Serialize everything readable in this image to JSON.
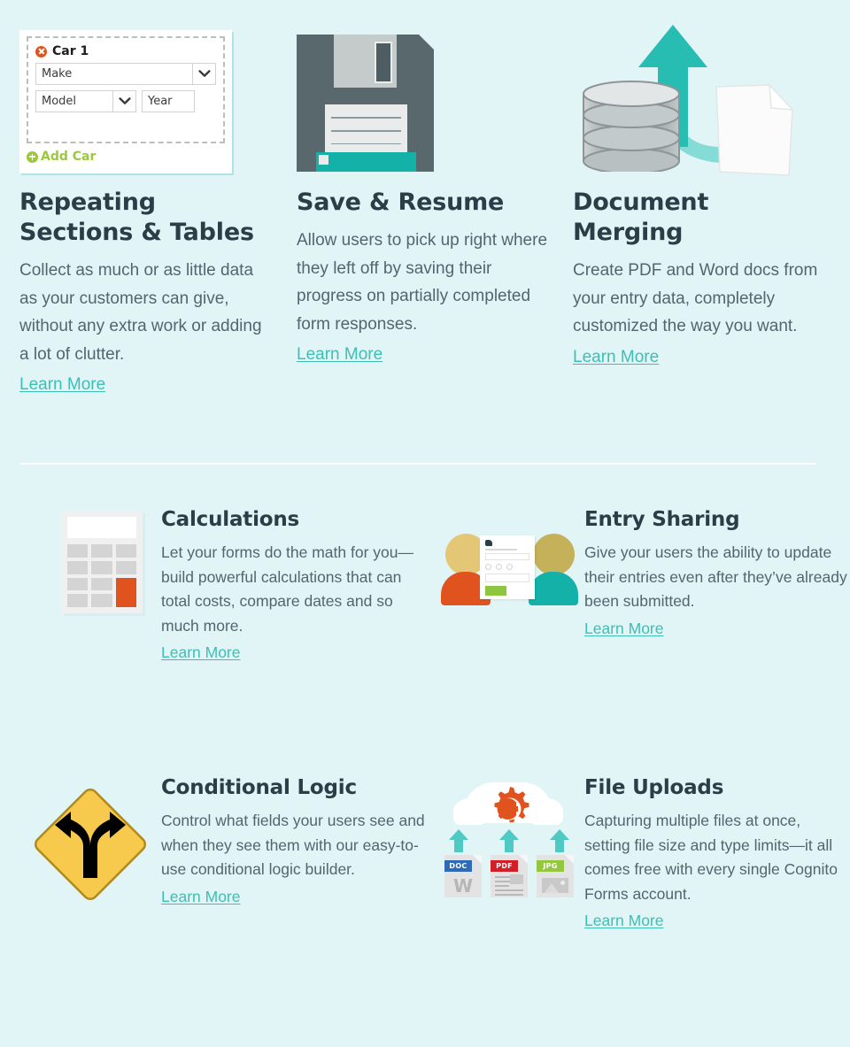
{
  "theme": {
    "background": "#e1f5f7",
    "heading_color": "#2b3d47",
    "body_color": "#55656e",
    "link_color": "#3cbfb4",
    "accent_teal": "#14b1a9",
    "accent_orange": "#e0531f",
    "accent_green": "#9ac93c",
    "divider_color": "#cfeef0"
  },
  "repeating_form_icon": {
    "section_label": "Car 1",
    "remove_icon": "remove-circle-icon",
    "fields": [
      {
        "label": "Make",
        "type": "dropdown"
      },
      {
        "label": "Model",
        "type": "dropdown"
      },
      {
        "label": "Year",
        "type": "text"
      }
    ],
    "add_label": "Add Car",
    "add_icon": "plus-circle-icon"
  },
  "file_upload_icon": {
    "cloud_icon": "cloud-icon",
    "gear_icon": "gear-c-icon",
    "files": [
      {
        "type": "DOC",
        "glyph": "W",
        "badge_color": "#2e6bb5"
      },
      {
        "type": "PDF",
        "glyph": "",
        "badge_color": "#cf2027"
      },
      {
        "type": "JPG",
        "glyph": "",
        "badge_color": "#93c83e"
      }
    ],
    "arrow_icon": "upload-arrow-icon"
  },
  "features_top": [
    {
      "id": "repeating-sections-tables",
      "title": "Repeating\nSections & Tables",
      "title_line1": "Repeating",
      "title_line2": "Sections & Tables",
      "description": "Collect as much or as little data as your customers can give, without any extra work or adding a lot of clutter.",
      "link_label": "Learn More",
      "icon": "repeating-section-form-icon"
    },
    {
      "id": "save-resume",
      "title": "Save & Resume",
      "title_line1": "Save & Resume",
      "title_line2": "",
      "description": "Allow users to pick up right where they left off by saving their progress on partially completed form responses.",
      "link_label": "Learn More",
      "icon": "floppy-disk-icon"
    },
    {
      "id": "document-merging",
      "title": "Document Merging",
      "title_line1": "Document",
      "title_line2": "Merging",
      "description": "Create PDF and Word docs from your entry data, completely customized the way you want.",
      "link_label": "Learn More",
      "icon": "database-document-merge-icon"
    }
  ],
  "features_rows": [
    {
      "id": "calculations",
      "title": "Calculations",
      "description": "Let your forms do the math for you—build powerful calculations that can total costs, compare dates and so much more.",
      "link_label": "Learn More",
      "icon": "calculator-icon"
    },
    {
      "id": "entry-sharing",
      "title": "Entry Sharing",
      "description": "Give your users the ability to update their entries even after they’ve already been submitted.",
      "link_label": "Learn More",
      "icon": "entry-sharing-people-icon"
    },
    {
      "id": "conditional-logic",
      "title": "Conditional Logic",
      "description": "Control what fields your users see and when they see them with our easy-to-use conditional logic builder.",
      "link_label": "Learn More",
      "icon": "fork-road-sign-icon"
    },
    {
      "id": "file-uploads",
      "title": "File Uploads",
      "description": "Capturing multiple files at once, setting file size and type limits—it all comes free with every single Cognito Forms account.",
      "link_label": "Learn More",
      "icon": "cloud-file-upload-icon"
    }
  ]
}
